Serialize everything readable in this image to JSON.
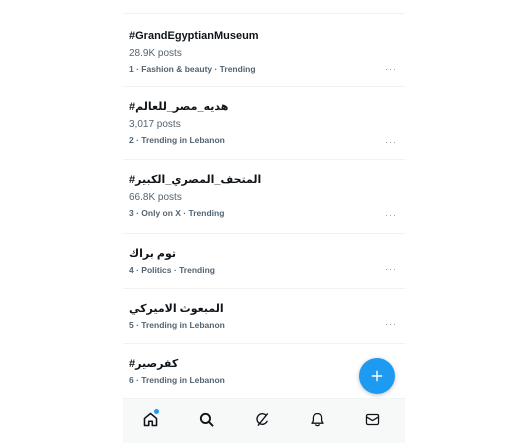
{
  "trends": [
    {
      "tag": "#GrandEgyptianMuseum",
      "count": "28.9K posts",
      "meta": "1 · Fashion & beauty · Trending"
    },
    {
      "tag": "#هديه_مصر_للعالم",
      "count": "3,017 posts",
      "meta": "2 · Trending in Lebanon"
    },
    {
      "tag": "#المتحف_المصري_الكبير",
      "count": "66.8K posts",
      "meta": "3 · Only on X · Trending"
    },
    {
      "tag": "توم براك",
      "count": "",
      "meta": "4 · Politics · Trending"
    },
    {
      "tag": "المبعوث الاميركي",
      "count": "",
      "meta": "5 · Trending in Lebanon"
    },
    {
      "tag": "#كفرصير",
      "count": "",
      "meta": "6 · Trending in Lebanon"
    }
  ],
  "more_label": "···",
  "icons": {
    "fab": "plus-icon",
    "nav": [
      "home-icon",
      "search-icon",
      "grok-icon",
      "notifications-icon",
      "messages-icon"
    ]
  },
  "colors": {
    "accent": "#1d9bf0",
    "text": "#0f1419",
    "secondary": "#536471"
  }
}
